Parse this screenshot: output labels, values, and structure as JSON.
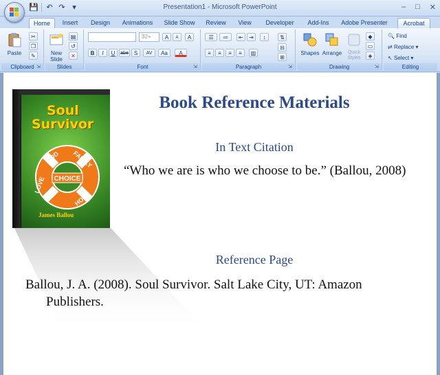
{
  "window": {
    "title": "Presentation1 - Microsoft PowerPoint",
    "controls": [
      "–",
      "□",
      "✕"
    ]
  },
  "tabs": [
    {
      "label": "Home",
      "active": true
    },
    {
      "label": "Insert"
    },
    {
      "label": "Design"
    },
    {
      "label": "Animations"
    },
    {
      "label": "Slide Show"
    },
    {
      "label": "Review"
    },
    {
      "label": "View"
    },
    {
      "label": "Developer"
    },
    {
      "label": "Add-Ins"
    },
    {
      "label": "Adobe Presenter"
    },
    {
      "label": "Acrobat"
    }
  ],
  "ribbon": {
    "clipboard": {
      "label": "Clipboard",
      "paste": "Paste"
    },
    "slides": {
      "label": "Slides",
      "new_slide": "New Slide"
    },
    "font": {
      "label": "Font",
      "size": "32+",
      "bold": "B",
      "italic": "I",
      "underline": "U",
      "strike": "abe",
      "shadow": "S",
      "spacing": "AV",
      "case": "Aa",
      "color": "A",
      "grow": "A",
      "shrink": "A",
      "clear": "A"
    },
    "paragraph": {
      "label": "Paragraph"
    },
    "drawing": {
      "label": "Drawing",
      "shapes": "Shapes",
      "arrange": "Arrange",
      "quick_styles": "Quick Styles"
    },
    "editing": {
      "label": "Editing",
      "find": "Find",
      "replace": "Replace",
      "select": "Select"
    }
  },
  "slide": {
    "title": "Book Reference Materials",
    "subheading1": "In Text Citation",
    "quote": "“Who we are is who we choose to be.” (Ballou, 2008)",
    "subheading2": "Reference Page",
    "reference": "Ballou, J. A. (2008). Soul Survivor. Salt Lake City, UT: Amazon Publishers."
  },
  "book": {
    "title_line1": "Soul",
    "title_line2": "Survivor",
    "author": "James Ballou",
    "ring_words": [
      "GOD",
      "FAMILY",
      "HOPE",
      "LOVE"
    ],
    "ring_center": "CHOICE"
  },
  "colors": {
    "accent": "#2c4a86",
    "ribbon": "#dbe7f6",
    "book_green": "#3a8a26",
    "book_yellow": "#ffd000",
    "ring_orange": "#f07a1a"
  }
}
